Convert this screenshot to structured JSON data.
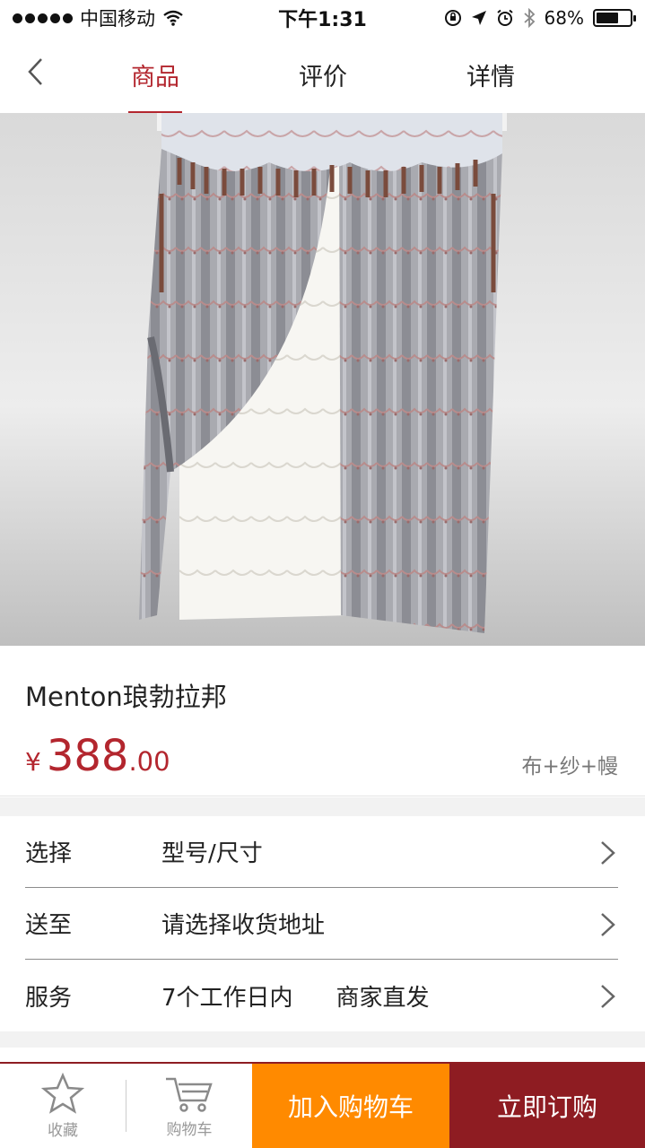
{
  "status_bar": {
    "carrier": "中国移动",
    "time": "下午1:31",
    "battery": "68%",
    "battery_level": 0.68,
    "icons": [
      "signal-dots",
      "wifi-icon",
      "orientation-lock-icon",
      "location-arrow-icon",
      "alarm-icon",
      "bluetooth-icon",
      "battery-icon"
    ]
  },
  "header": {
    "back_icon": "chevron-left-icon",
    "tabs": [
      {
        "label": "商品",
        "active": true
      },
      {
        "label": "评价",
        "active": false
      },
      {
        "label": "详情",
        "active": false
      }
    ],
    "accent_color": "#b3262e"
  },
  "product": {
    "image": "curtain-product-photo",
    "name": "Menton琅勃拉邦",
    "price_currency": "¥",
    "price_int": "388",
    "price_dec": ".00",
    "variant": "布+纱+幔"
  },
  "options": [
    {
      "label": "选择",
      "value": "型号/尺寸",
      "value2": ""
    },
    {
      "label": "送至",
      "value": "请选择收货地址",
      "value2": ""
    },
    {
      "label": "服务",
      "value": "7个工作日内",
      "value2": "商家直发"
    }
  ],
  "bottom_bar": {
    "favorite_label": "收藏",
    "cart_label": "购物车",
    "add_to_cart": "加入购物车",
    "buy_now": "立即订购",
    "add_to_cart_color": "#ff8a00",
    "buy_now_color": "#8e1c22"
  }
}
